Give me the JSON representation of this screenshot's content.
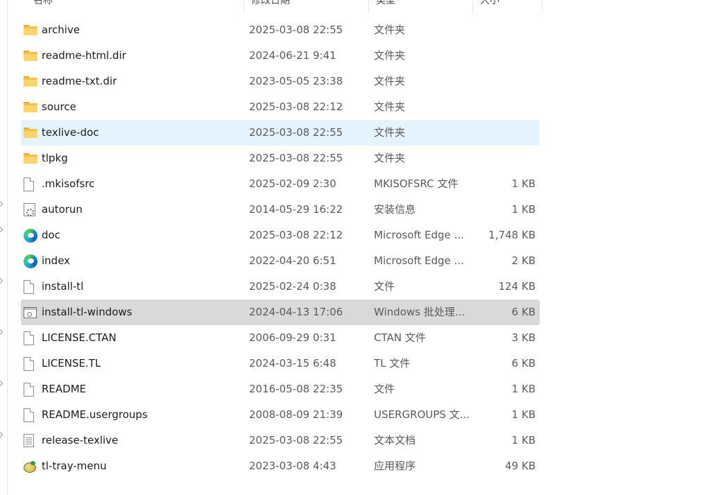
{
  "columns": {
    "name": "名称",
    "date": "修改日期",
    "type": "类型",
    "size": "大小"
  },
  "files": [
    {
      "icon": "folder-icon",
      "name": "archive",
      "date": "2025-03-08 22:55",
      "type": "文件夹",
      "size": ""
    },
    {
      "icon": "folder-icon",
      "name": "readme-html.dir",
      "date": "2024-06-21 9:41",
      "type": "文件夹",
      "size": ""
    },
    {
      "icon": "folder-icon",
      "name": "readme-txt.dir",
      "date": "2023-05-05 23:38",
      "type": "文件夹",
      "size": ""
    },
    {
      "icon": "folder-icon",
      "name": "source",
      "date": "2025-03-08 22:12",
      "type": "文件夹",
      "size": ""
    },
    {
      "icon": "folder-icon",
      "name": "texlive-doc",
      "date": "2025-03-08 22:55",
      "type": "文件夹",
      "size": "",
      "state": "selected"
    },
    {
      "icon": "folder-icon",
      "name": "tlpkg",
      "date": "2025-03-08 22:55",
      "type": "文件夹",
      "size": ""
    },
    {
      "icon": "file-icon",
      "name": ".mkisofsrc",
      "date": "2025-02-09 2:30",
      "type": "MKISOFSRC 文件",
      "size": "1 KB"
    },
    {
      "icon": "config-icon",
      "name": "autorun",
      "date": "2014-05-29 16:22",
      "type": "安装信息",
      "size": "1 KB"
    },
    {
      "icon": "edge-icon",
      "name": "doc",
      "date": "2025-03-08 22:12",
      "type": "Microsoft Edge ...",
      "size": "1,748 KB"
    },
    {
      "icon": "edge-icon",
      "name": "index",
      "date": "2022-04-20 6:51",
      "type": "Microsoft Edge ...",
      "size": "2 KB"
    },
    {
      "icon": "file-icon",
      "name": "install-tl",
      "date": "2025-02-24 0:38",
      "type": "文件",
      "size": "124 KB"
    },
    {
      "icon": "batch-icon",
      "name": "install-tl-windows",
      "date": "2024-04-13 17:06",
      "type": "Windows 批处理...",
      "size": "6 KB",
      "state": "hovered"
    },
    {
      "icon": "file-icon",
      "name": "LICENSE.CTAN",
      "date": "2006-09-29 0:31",
      "type": "CTAN 文件",
      "size": "3 KB"
    },
    {
      "icon": "file-icon",
      "name": "LICENSE.TL",
      "date": "2024-03-15 6:48",
      "type": "TL 文件",
      "size": "6 KB"
    },
    {
      "icon": "file-icon",
      "name": "README",
      "date": "2016-05-08 22:35",
      "type": "文件",
      "size": "1 KB"
    },
    {
      "icon": "file-icon",
      "name": "README.usergroups",
      "date": "2008-08-09 21:39",
      "type": "USERGROUPS 文...",
      "size": "1 KB"
    },
    {
      "icon": "text-icon",
      "name": "release-texlive",
      "date": "2025-03-08 22:55",
      "type": "文本文档",
      "size": "1 KB"
    },
    {
      "icon": "app-icon",
      "name": "tl-tray-menu",
      "date": "2023-03-08 4:43",
      "type": "应用程序",
      "size": "49 KB"
    }
  ],
  "colors": {
    "selected_row": "#e5f3fe",
    "hovered_row": "#d9d9d9",
    "folder": "#f5c04a"
  }
}
